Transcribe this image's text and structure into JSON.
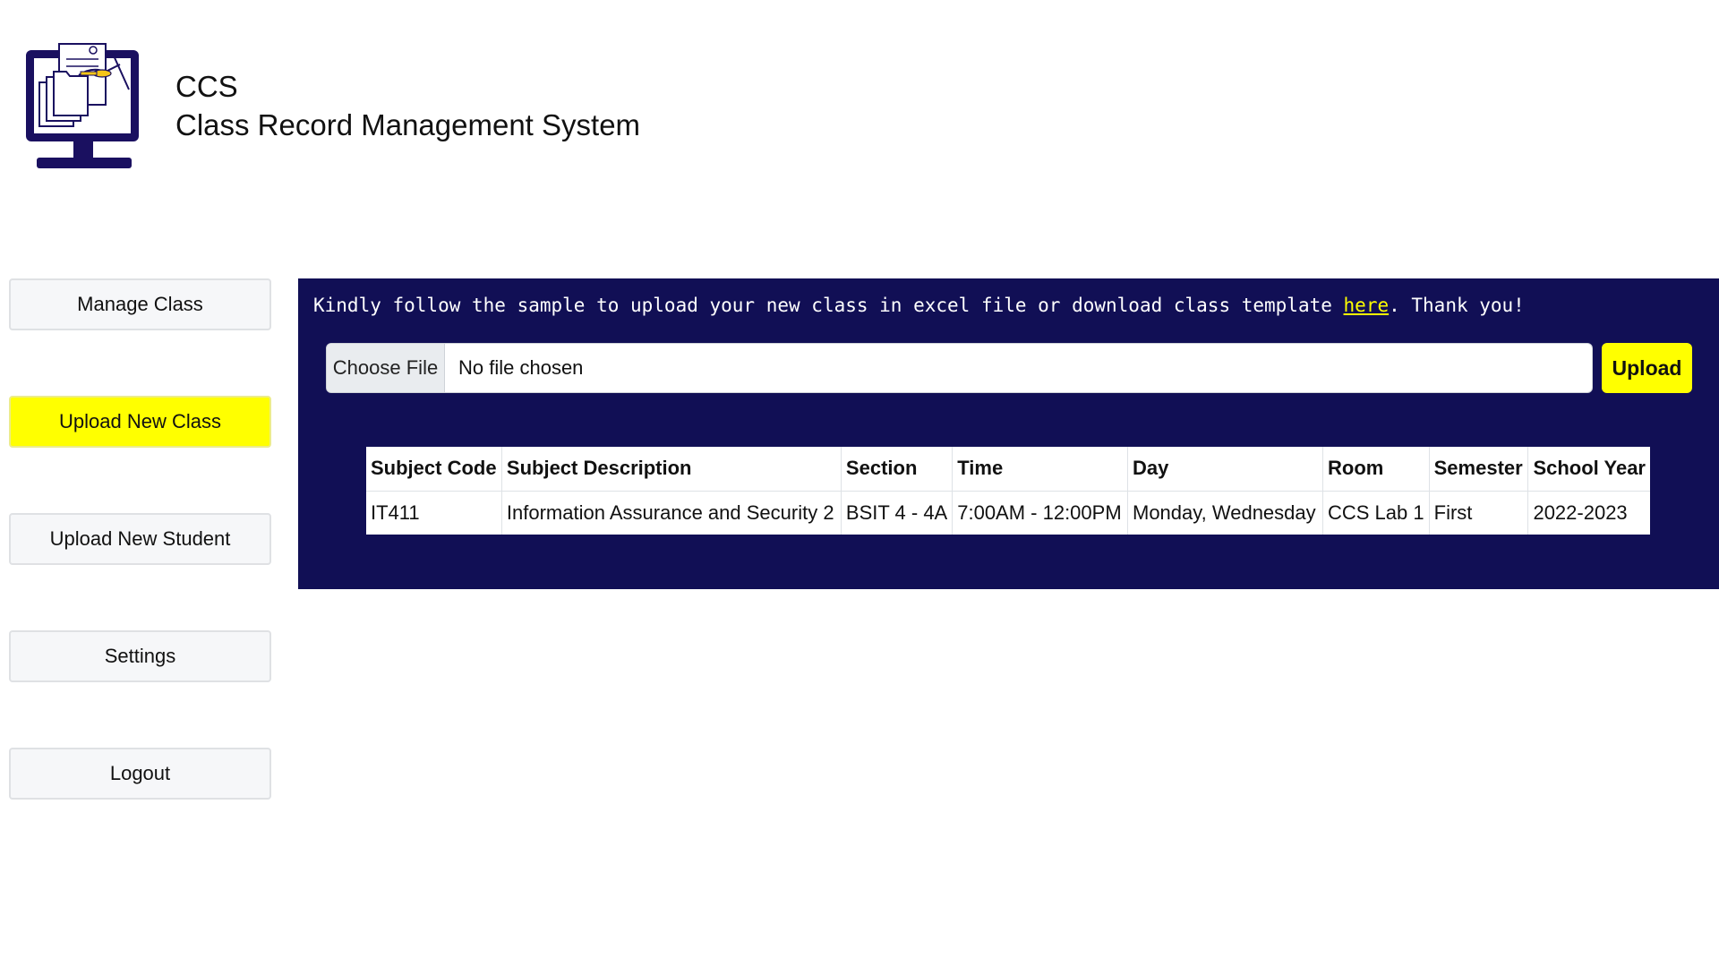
{
  "header": {
    "short_name": "CCS",
    "full_name": "Class Record Management System"
  },
  "sidebar": {
    "items": [
      {
        "label": "Manage Class",
        "active": false
      },
      {
        "label": "Upload New Class",
        "active": true
      },
      {
        "label": "Upload New Student",
        "active": false
      },
      {
        "label": "Settings",
        "active": false
      },
      {
        "label": "Logout",
        "active": false
      }
    ]
  },
  "upload": {
    "notice_before": "Kindly follow the sample to upload your new class in excel file or download class template ",
    "notice_link": "here",
    "notice_after": ". Thank you!",
    "choose_file_label": "Choose File",
    "file_status": "No file chosen",
    "upload_label": "Upload"
  },
  "table": {
    "headers": [
      "Subject Code",
      "Subject Description",
      "Section",
      "Time",
      "Day",
      "Room",
      "Semester",
      "School Year"
    ],
    "rows": [
      [
        "IT411",
        "Information Assurance and Security 2",
        "BSIT 4 - 4A",
        "7:00AM - 12:00PM",
        "Monday, Wednesday",
        "CCS Lab 1",
        "First",
        "2022-2023"
      ]
    ]
  },
  "colors": {
    "panel_bg": "#110f55",
    "accent": "#ffff00",
    "logo": "#1a1060"
  },
  "icons": {
    "logo": "computer-monitor-documents-icon"
  }
}
